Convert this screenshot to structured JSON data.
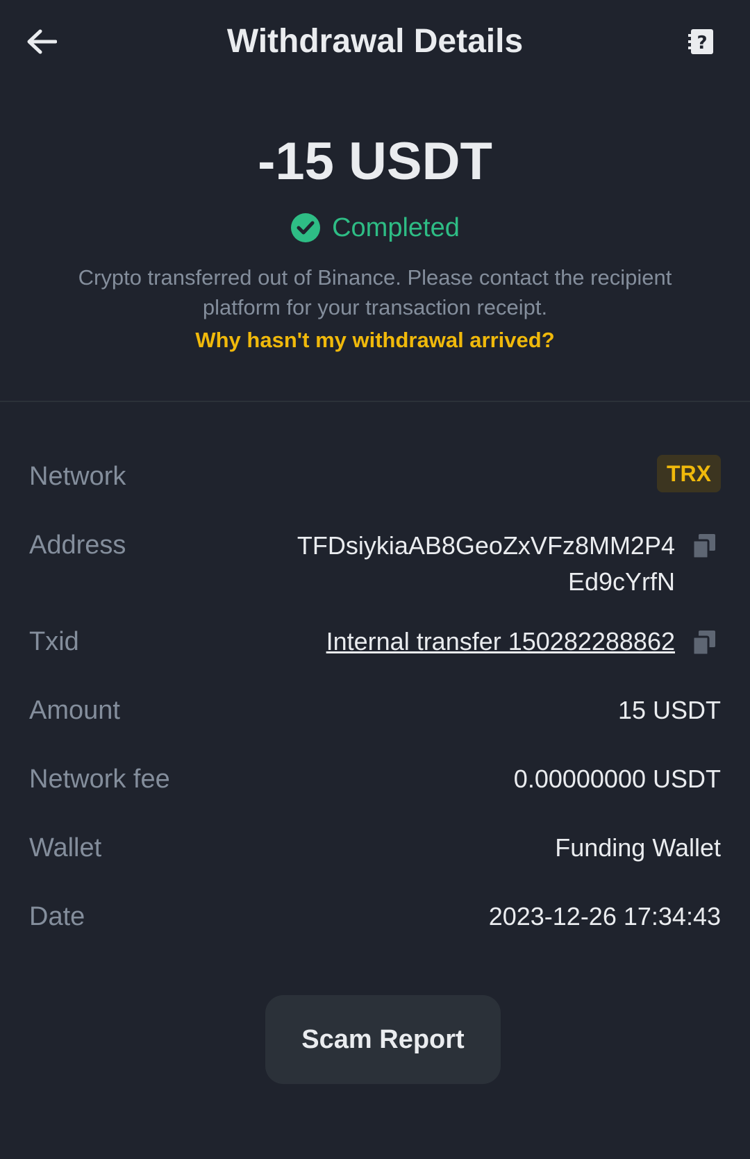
{
  "header": {
    "title": "Withdrawal Details",
    "back_icon": "arrow-left-icon",
    "help_icon": "help-document-icon"
  },
  "summary": {
    "amount": "-15 USDT",
    "status": "Completed",
    "status_icon": "check-circle-icon",
    "description": "Crypto transferred out of Binance. Please contact the recipient platform for your transaction receipt.",
    "help_link": "Why hasn't my withdrawal arrived?"
  },
  "details": {
    "network_label": "Network",
    "network_value": "TRX",
    "address_label": "Address",
    "address_value": "TFDsiykiaAB8GeoZxVFz8MM2P4Ed9cYrfN",
    "txid_label": "Txid",
    "txid_value": "Internal transfer 150282288862",
    "amount_label": "Amount",
    "amount_value": "15 USDT",
    "fee_label": "Network fee",
    "fee_value": "0.00000000 USDT",
    "wallet_label": "Wallet",
    "wallet_value": "Funding Wallet",
    "date_label": "Date",
    "date_value": "2023-12-26 17:34:43"
  },
  "actions": {
    "scam_report": "Scam Report"
  },
  "colors": {
    "background": "#1f232d",
    "success": "#2ebd85",
    "accent": "#f0b90b",
    "muted_text": "#848e9c",
    "primary_text": "#eaecef"
  }
}
